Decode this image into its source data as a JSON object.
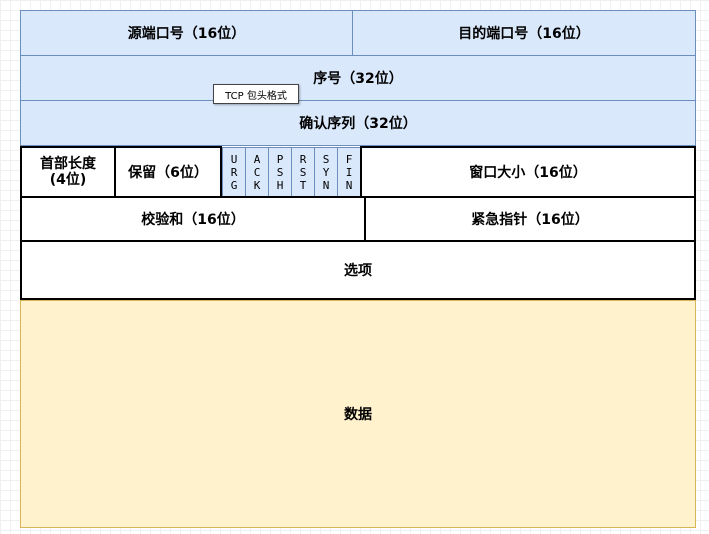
{
  "caption": "TCP 包头格式",
  "rows": {
    "src_port": "源端口号（16位）",
    "dst_port": "目的端口号（16位）",
    "seq": "序号（32位）",
    "ack": "确认序列（32位）",
    "header_len_line1": "首部长度",
    "header_len_line2": "(4位)",
    "reserved": "保留（6位）",
    "window": "窗口大小（16位）",
    "checksum": "校验和（16位）",
    "urgent": "紧急指针（16位）",
    "options": "选项",
    "data": "数据"
  },
  "flags": [
    [
      "U",
      "R",
      "G"
    ],
    [
      "A",
      "C",
      "K"
    ],
    [
      "P",
      "S",
      "H"
    ],
    [
      "R",
      "S",
      "T"
    ],
    [
      "S",
      "Y",
      "N"
    ],
    [
      "F",
      "I",
      "N"
    ]
  ],
  "colors": {
    "header_fill": "#dae8fc",
    "header_stroke": "#6c8ebf",
    "data_fill": "#fff2cc",
    "data_stroke": "#d6b656"
  }
}
